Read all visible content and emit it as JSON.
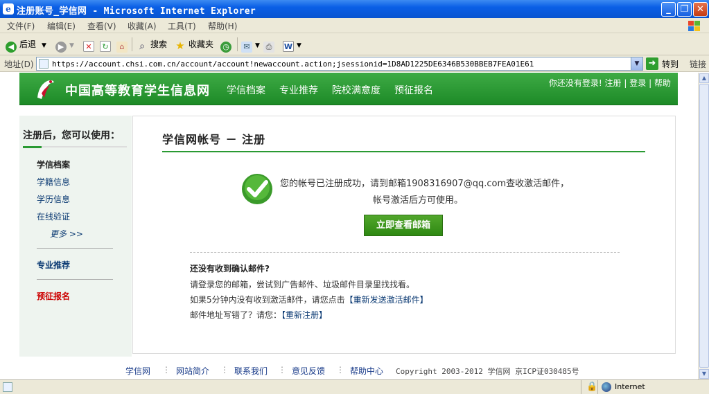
{
  "window": {
    "title": "注册账号_学信网 - Microsoft Internet Explorer",
    "minimize": "_",
    "maximize": "❐",
    "close": "✕"
  },
  "menu": [
    "文件(F)",
    "编辑(E)",
    "查看(V)",
    "收藏(A)",
    "工具(T)",
    "帮助(H)"
  ],
  "toolbar": {
    "back": "后退",
    "search": "搜索",
    "favorites": "收藏夹"
  },
  "address": {
    "label": "地址(D)",
    "url": "https://account.chsi.com.cn/account/account!newaccount.action;jsessionid=1D8AD1225DE6346B530BBEB7FEA01E61",
    "go": "转到",
    "links": "链接"
  },
  "site": {
    "name": "中国高等教育学生信息网",
    "nav": [
      "学信档案",
      "专业推荐",
      "院校满意度",
      "预征报名"
    ],
    "top_status": "你还没有登录!",
    "register": "注册",
    "login": "登录",
    "help": "帮助"
  },
  "sidebar": {
    "title": "注册后，您可以使用：",
    "section1": "学信档案",
    "items": [
      "学籍信息",
      "学历信息",
      "在线验证"
    ],
    "more": "更多 >>",
    "section2": "专业推荐",
    "section3": "预征报名"
  },
  "main": {
    "title": "学信网帐号 － 注册",
    "success_line1": "您的帐号已注册成功，请到邮箱1908316907@qq.com查收激活邮件，",
    "success_line2": "帐号激活后方可使用。",
    "button": "立即查看邮箱",
    "help_title": "还没有收到确认邮件?",
    "help1": "请登录您的邮箱，尝试到广告邮件、垃圾邮件目录里找找看。",
    "help2_prefix": "如果5分钟内没有收到激活邮件，请您点击",
    "help2_link": "【重新发送激活邮件】",
    "help3_prefix": "邮件地址写错了？请您：",
    "help3_link": "【重新注册】"
  },
  "footer": {
    "links": [
      "学信网",
      "网站简介",
      "联系我们",
      "意见反馈",
      "帮助中心"
    ],
    "copyright": "Copyright 2003-2012 学信网 京ICP证030485号"
  },
  "status": {
    "zone": "Internet"
  },
  "colors": {
    "brand_green": "#2a9a33",
    "link_blue": "#0b3a73",
    "red": "#cc0000"
  }
}
